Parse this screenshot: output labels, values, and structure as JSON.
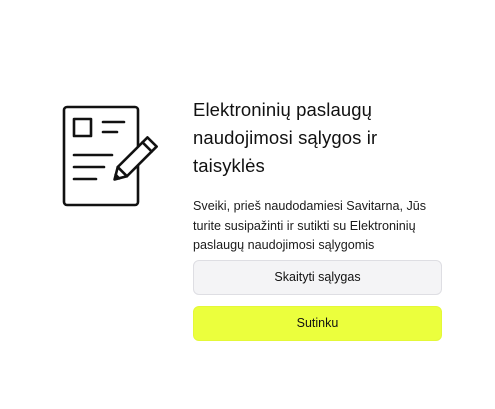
{
  "illustration": {
    "icon": "document-pencil-icon"
  },
  "terms": {
    "title": "Elektroninių paslaugų naudojimosi sąlygos ir taisyklės",
    "description": "Sveiki, prieš naudodamiesi Savitarna, Jūs turite susipažinti ir sutikti su Elektroninių paslaugų naudojimosi sąlygomis"
  },
  "buttons": {
    "read_label": "Skaityti sąlygas",
    "agree_label": "Sutinku"
  },
  "colors": {
    "primary_button": "#ebff3d",
    "secondary_button": "#f4f4f6",
    "text": "#111111"
  }
}
